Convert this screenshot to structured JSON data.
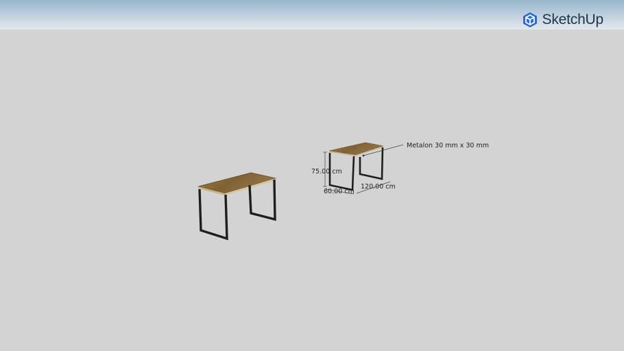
{
  "viewer": {
    "brand": "SketchUp",
    "brand_icon": "sketchup-logo-icon",
    "colors": {
      "sky_top": "#97b5cc",
      "ground": "#d3d3d3",
      "wood": "#8a6a3c",
      "frame": "#1e1e1e",
      "brand_text": "#1c3549",
      "brand_icon": "#2a6ad6"
    }
  },
  "annotations": {
    "label": "Metalon 30 mm x 30 mm",
    "height": "75.00 cm",
    "depth": "60.00 cm",
    "width": "120.00 cm"
  }
}
